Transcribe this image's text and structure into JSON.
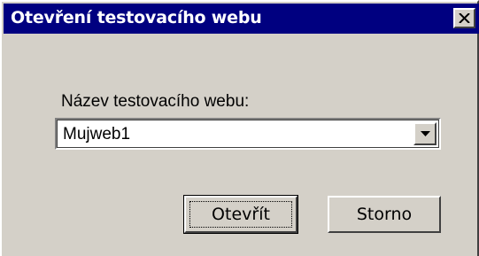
{
  "window": {
    "title": "Otevření testovacího webu",
    "close_icon": "close-icon"
  },
  "form": {
    "site_name_label": "Název testovacího webu:",
    "site_name_value": "Mujweb1",
    "dropdown_icon": "chevron-down-icon"
  },
  "buttons": {
    "open_label": "Otevřít",
    "cancel_label": "Storno"
  },
  "colors": {
    "titlebar": "#000080",
    "face": "#d4d0c8",
    "title_text": "#ffffff"
  }
}
